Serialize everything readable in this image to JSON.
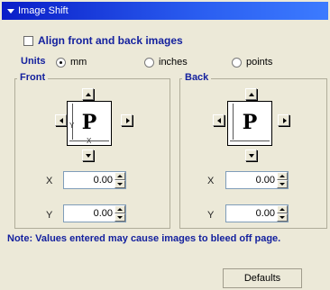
{
  "title": "Image Shift",
  "align_label": "Align front and back images",
  "units": {
    "label": "Units",
    "options": [
      "mm",
      "inches",
      "points"
    ],
    "selected": "mm"
  },
  "front": {
    "label": "Front",
    "x_label": "X",
    "y_label": "Y",
    "x_value": "0.00",
    "y_value": "0.00"
  },
  "back": {
    "label": "Back",
    "x_label": "X",
    "y_label": "Y",
    "x_value": "0.00",
    "y_value": "0.00"
  },
  "preview": {
    "letter": "P",
    "y_mark": "Y",
    "x_mark": "X"
  },
  "note": "Note:  Values entered may cause images to bleed off page.",
  "defaults_label": "Defaults",
  "colors": {
    "title_bar": "#0a1ec8",
    "label_blue": "#14219e",
    "panel_bg": "#ece9d8"
  },
  "icons": {
    "collapse": "triangle-down-icon",
    "nudge": "arrow-icons"
  }
}
